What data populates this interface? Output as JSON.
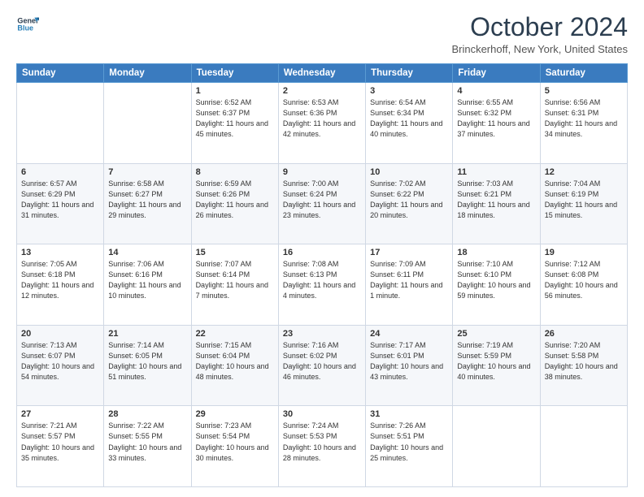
{
  "header": {
    "logo_line1": "General",
    "logo_line2": "Blue",
    "month_title": "October 2024",
    "location": "Brinckerhoff, New York, United States"
  },
  "days_of_week": [
    "Sunday",
    "Monday",
    "Tuesday",
    "Wednesday",
    "Thursday",
    "Friday",
    "Saturday"
  ],
  "weeks": [
    [
      {
        "day": "",
        "info": ""
      },
      {
        "day": "",
        "info": ""
      },
      {
        "day": "1",
        "info": "Sunrise: 6:52 AM\nSunset: 6:37 PM\nDaylight: 11 hours and 45 minutes."
      },
      {
        "day": "2",
        "info": "Sunrise: 6:53 AM\nSunset: 6:36 PM\nDaylight: 11 hours and 42 minutes."
      },
      {
        "day": "3",
        "info": "Sunrise: 6:54 AM\nSunset: 6:34 PM\nDaylight: 11 hours and 40 minutes."
      },
      {
        "day": "4",
        "info": "Sunrise: 6:55 AM\nSunset: 6:32 PM\nDaylight: 11 hours and 37 minutes."
      },
      {
        "day": "5",
        "info": "Sunrise: 6:56 AM\nSunset: 6:31 PM\nDaylight: 11 hours and 34 minutes."
      }
    ],
    [
      {
        "day": "6",
        "info": "Sunrise: 6:57 AM\nSunset: 6:29 PM\nDaylight: 11 hours and 31 minutes."
      },
      {
        "day": "7",
        "info": "Sunrise: 6:58 AM\nSunset: 6:27 PM\nDaylight: 11 hours and 29 minutes."
      },
      {
        "day": "8",
        "info": "Sunrise: 6:59 AM\nSunset: 6:26 PM\nDaylight: 11 hours and 26 minutes."
      },
      {
        "day": "9",
        "info": "Sunrise: 7:00 AM\nSunset: 6:24 PM\nDaylight: 11 hours and 23 minutes."
      },
      {
        "day": "10",
        "info": "Sunrise: 7:02 AM\nSunset: 6:22 PM\nDaylight: 11 hours and 20 minutes."
      },
      {
        "day": "11",
        "info": "Sunrise: 7:03 AM\nSunset: 6:21 PM\nDaylight: 11 hours and 18 minutes."
      },
      {
        "day": "12",
        "info": "Sunrise: 7:04 AM\nSunset: 6:19 PM\nDaylight: 11 hours and 15 minutes."
      }
    ],
    [
      {
        "day": "13",
        "info": "Sunrise: 7:05 AM\nSunset: 6:18 PM\nDaylight: 11 hours and 12 minutes."
      },
      {
        "day": "14",
        "info": "Sunrise: 7:06 AM\nSunset: 6:16 PM\nDaylight: 11 hours and 10 minutes."
      },
      {
        "day": "15",
        "info": "Sunrise: 7:07 AM\nSunset: 6:14 PM\nDaylight: 11 hours and 7 minutes."
      },
      {
        "day": "16",
        "info": "Sunrise: 7:08 AM\nSunset: 6:13 PM\nDaylight: 11 hours and 4 minutes."
      },
      {
        "day": "17",
        "info": "Sunrise: 7:09 AM\nSunset: 6:11 PM\nDaylight: 11 hours and 1 minute."
      },
      {
        "day": "18",
        "info": "Sunrise: 7:10 AM\nSunset: 6:10 PM\nDaylight: 10 hours and 59 minutes."
      },
      {
        "day": "19",
        "info": "Sunrise: 7:12 AM\nSunset: 6:08 PM\nDaylight: 10 hours and 56 minutes."
      }
    ],
    [
      {
        "day": "20",
        "info": "Sunrise: 7:13 AM\nSunset: 6:07 PM\nDaylight: 10 hours and 54 minutes."
      },
      {
        "day": "21",
        "info": "Sunrise: 7:14 AM\nSunset: 6:05 PM\nDaylight: 10 hours and 51 minutes."
      },
      {
        "day": "22",
        "info": "Sunrise: 7:15 AM\nSunset: 6:04 PM\nDaylight: 10 hours and 48 minutes."
      },
      {
        "day": "23",
        "info": "Sunrise: 7:16 AM\nSunset: 6:02 PM\nDaylight: 10 hours and 46 minutes."
      },
      {
        "day": "24",
        "info": "Sunrise: 7:17 AM\nSunset: 6:01 PM\nDaylight: 10 hours and 43 minutes."
      },
      {
        "day": "25",
        "info": "Sunrise: 7:19 AM\nSunset: 5:59 PM\nDaylight: 10 hours and 40 minutes."
      },
      {
        "day": "26",
        "info": "Sunrise: 7:20 AM\nSunset: 5:58 PM\nDaylight: 10 hours and 38 minutes."
      }
    ],
    [
      {
        "day": "27",
        "info": "Sunrise: 7:21 AM\nSunset: 5:57 PM\nDaylight: 10 hours and 35 minutes."
      },
      {
        "day": "28",
        "info": "Sunrise: 7:22 AM\nSunset: 5:55 PM\nDaylight: 10 hours and 33 minutes."
      },
      {
        "day": "29",
        "info": "Sunrise: 7:23 AM\nSunset: 5:54 PM\nDaylight: 10 hours and 30 minutes."
      },
      {
        "day": "30",
        "info": "Sunrise: 7:24 AM\nSunset: 5:53 PM\nDaylight: 10 hours and 28 minutes."
      },
      {
        "day": "31",
        "info": "Sunrise: 7:26 AM\nSunset: 5:51 PM\nDaylight: 10 hours and 25 minutes."
      },
      {
        "day": "",
        "info": ""
      },
      {
        "day": "",
        "info": ""
      }
    ]
  ]
}
